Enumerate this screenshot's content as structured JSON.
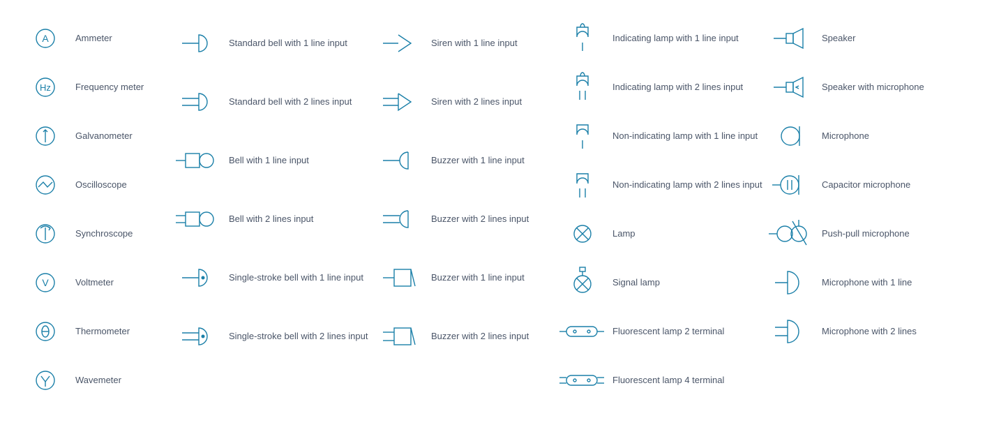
{
  "columns": [
    {
      "items": [
        {
          "id": "ammeter",
          "label": "Ammeter"
        },
        {
          "id": "frequency-meter",
          "label": "Frequency meter"
        },
        {
          "id": "galvanometer",
          "label": "Galvanometer"
        },
        {
          "id": "oscilloscope",
          "label": "Oscilloscope"
        },
        {
          "id": "synchroscope",
          "label": "Synchroscope"
        },
        {
          "id": "voltmeter",
          "label": "Voltmeter"
        },
        {
          "id": "thermometer",
          "label": "Thermometer"
        },
        {
          "id": "wavemeter",
          "label": "Wavemeter"
        }
      ]
    },
    {
      "items": [
        {
          "id": "std-bell-1",
          "label": "Standard bell with 1 line input",
          "tall": true
        },
        {
          "id": "std-bell-2",
          "label": "Standard bell with 2 lines input",
          "tall": true
        },
        {
          "id": "bell-1",
          "label": "Bell with 1 line input",
          "tall": true
        },
        {
          "id": "bell-2",
          "label": "Bell with 2 lines input",
          "tall": true
        },
        {
          "id": "single-bell-1",
          "label": "Single-stroke bell with 1 line input",
          "tall": true
        },
        {
          "id": "single-bell-2",
          "label": "Single-stroke bell with 2 lines input",
          "tall": true
        }
      ]
    },
    {
      "items": [
        {
          "id": "siren-1",
          "label": "Siren with\n1 line input",
          "tall": true
        },
        {
          "id": "siren-2",
          "label": "Siren with\n2 lines input",
          "tall": true
        },
        {
          "id": "buzzer-arc-1",
          "label": "Buzzer with 1 line input",
          "tall": true
        },
        {
          "id": "buzzer-arc-2",
          "label": "Buzzer with 2 lines input",
          "tall": true
        },
        {
          "id": "buzzer-sq-1",
          "label": "Buzzer with 1 line input",
          "tall": true
        },
        {
          "id": "buzzer-sq-2",
          "label": "Buzzer with 2 lines input",
          "tall": true
        }
      ]
    },
    {
      "items": [
        {
          "id": "ind-lamp-1",
          "label": "Indicating lamp with 1 line input"
        },
        {
          "id": "ind-lamp-2",
          "label": "Indicating lamp with 2 lines input"
        },
        {
          "id": "nonind-lamp-1",
          "label": "Non-indicating lamp with 1 line input"
        },
        {
          "id": "nonind-lamp-2",
          "label": "Non-indicating lamp with 2 lines input"
        },
        {
          "id": "lamp",
          "label": "Lamp"
        },
        {
          "id": "signal-lamp",
          "label": "Signal lamp"
        },
        {
          "id": "fluor-2",
          "label": "Fluorescent lamp 2 terminal"
        },
        {
          "id": "fluor-4",
          "label": "Fluorescent lamp 4 terminal"
        }
      ]
    },
    {
      "items": [
        {
          "id": "speaker",
          "label": "Speaker"
        },
        {
          "id": "speaker-mic",
          "label": "Speaker with microphone"
        },
        {
          "id": "microphone",
          "label": "Microphone"
        },
        {
          "id": "cap-mic",
          "label": "Capacitor microphone"
        },
        {
          "id": "push-pull-mic",
          "label": "Push-pull microphone"
        },
        {
          "id": "mic-1",
          "label": "Microphone with 1 line"
        },
        {
          "id": "mic-2",
          "label": "Microphone with 2 lines"
        }
      ]
    }
  ]
}
